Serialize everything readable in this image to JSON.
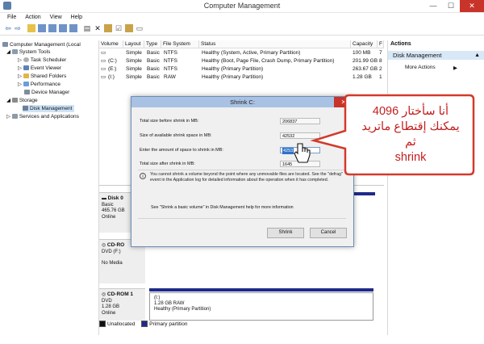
{
  "window": {
    "title": "Computer Management",
    "minimize": "—",
    "maximize": "☐",
    "close": "✕"
  },
  "menu": [
    "File",
    "Action",
    "View",
    "Help"
  ],
  "tree": {
    "root": "Computer Management (Local",
    "system_tools": "System Tools",
    "task_scheduler": "Task Scheduler",
    "event_viewer": "Event Viewer",
    "shared_folders": "Shared Folders",
    "performance": "Performance",
    "device_manager": "Device Manager",
    "storage": "Storage",
    "disk_management": "Disk Management",
    "services": "Services and Applications"
  },
  "volumes": {
    "headers": [
      "Volume",
      "Layout",
      "Type",
      "File System",
      "Status",
      "Capacity",
      "F"
    ],
    "rows": [
      {
        "volume": "",
        "layout": "Simple",
        "type": "Basic",
        "fs": "NTFS",
        "status": "Healthy (System, Active, Primary Partition)",
        "capacity": "100 MB",
        "free": "7"
      },
      {
        "volume": "(C:)",
        "layout": "Simple",
        "type": "Basic",
        "fs": "NTFS",
        "status": "Healthy (Boot, Page File, Crash Dump, Primary Partition)",
        "capacity": "201.99 GB",
        "free": "8"
      },
      {
        "volume": "(E:)",
        "layout": "Simple",
        "type": "Basic",
        "fs": "NTFS",
        "status": "Healthy (Primary Partition)",
        "capacity": "263.67 GB",
        "free": "2"
      },
      {
        "volume": "(I:)",
        "layout": "Simple",
        "type": "Basic",
        "fs": "RAW",
        "status": "Healthy (Primary Partition)",
        "capacity": "1.28 GB",
        "free": "1"
      }
    ]
  },
  "actions": {
    "header": "Actions",
    "section": "Disk Management",
    "more": "More Actions"
  },
  "disks": {
    "disk0": {
      "name": "Disk 0",
      "type": "Basic",
      "size": "465.76 GB",
      "status": "Online"
    },
    "cdrom0": {
      "name": "CD-RO",
      "drive": "DVD (F:)",
      "media": "No Media"
    },
    "cdrom1": {
      "name": "CD-ROM 1",
      "drive": "DVD",
      "size": "1.28 GB",
      "status": "Online"
    },
    "cdrom1_part": {
      "label": "(I:)",
      "size": "1.28 GB RAW",
      "status": "Healthy (Primary Partition)"
    }
  },
  "legend": {
    "unallocated": "Unallocated",
    "primary": "Primary partition"
  },
  "dialog": {
    "title": "Shrink C:",
    "close": "✕",
    "total_before_label": "Total size before shrink in MB:",
    "total_before_value": "206837",
    "available_label": "Size of available shrink space in MB:",
    "available_value": "42532",
    "amount_label": "Enter the amount of space to shrink in MB:",
    "amount_value": "4253",
    "after_label": "Total size after shrink in MB:",
    "after_value": "1645",
    "note": "You cannot shrink a volume beyond the point where any unmovable files are located. See the \"defrag\" event in the Application log for detailed information about the operation when it has completed.",
    "help": "See \"Shrink a basic volume\" in Disk Management help for more information",
    "shrink_btn": "Shrink",
    "cancel_btn": "Cancel"
  },
  "callout": {
    "line1": "أنا سأختار 4096",
    "line2": "يمكنك إقتطاع ماتريد",
    "line3": "ثم",
    "line4": "shrink"
  },
  "colors": {
    "primary_partition": "#1f2a8a",
    "callout_text": "#c41e1e",
    "callout_border": "#d23a2a"
  }
}
